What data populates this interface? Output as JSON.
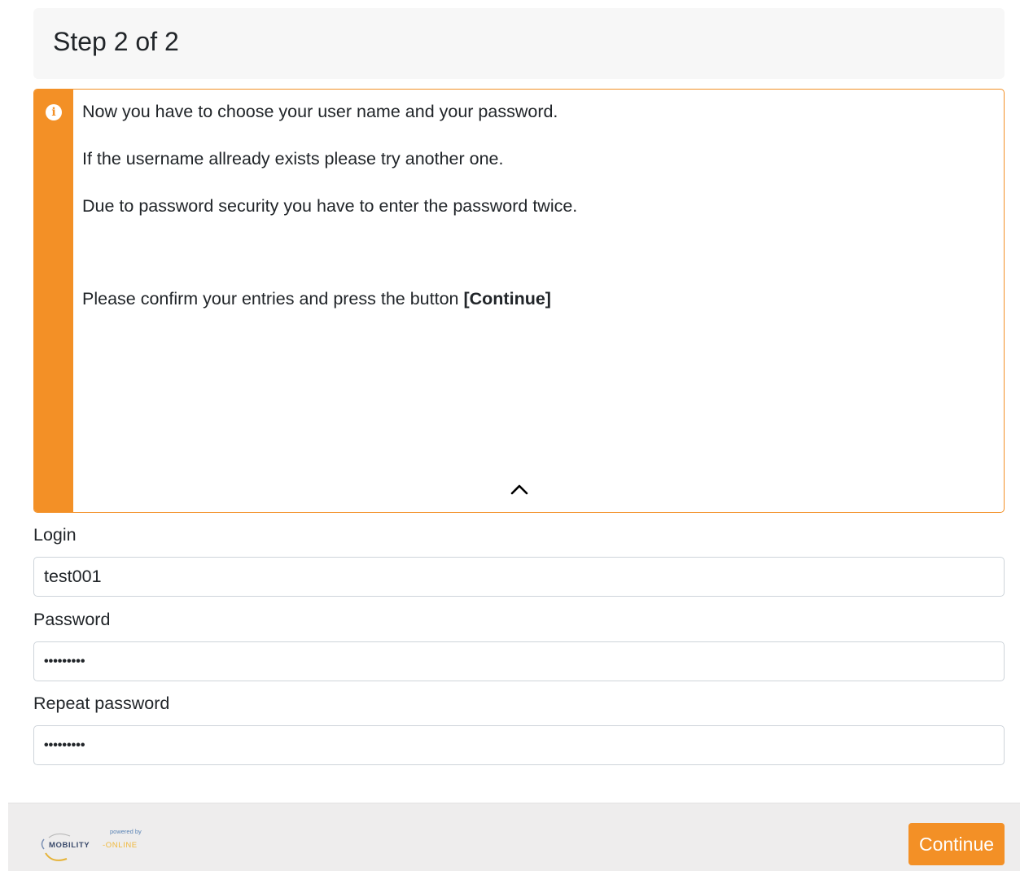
{
  "header": {
    "title": "Step 2 of 2"
  },
  "info": {
    "icon": "info-icon",
    "line1": "Now you have to choose your user name and your password.",
    "line2": "If the username allready exists please try another one.",
    "line3": "Due to password security you have to enter the password twice.",
    "line4_prefix": "Please confirm your entries and press the button ",
    "line4_bold": "[Continue]",
    "collapse_icon": "chevron-up-icon"
  },
  "form": {
    "login_label": "Login",
    "login_value": "test001",
    "password_label": "Password",
    "password_value": "•••••••••",
    "repeat_label": "Repeat password",
    "repeat_value": "•••••••••"
  },
  "footer": {
    "logo_powered": "powered by",
    "logo_name_1": "MOBILITY",
    "logo_name_2": "-ONLINE",
    "continue_label": "Continue"
  },
  "colors": {
    "accent": "#f39026",
    "header_bg": "#f7f7f7",
    "footer_bg": "#eeeded"
  }
}
